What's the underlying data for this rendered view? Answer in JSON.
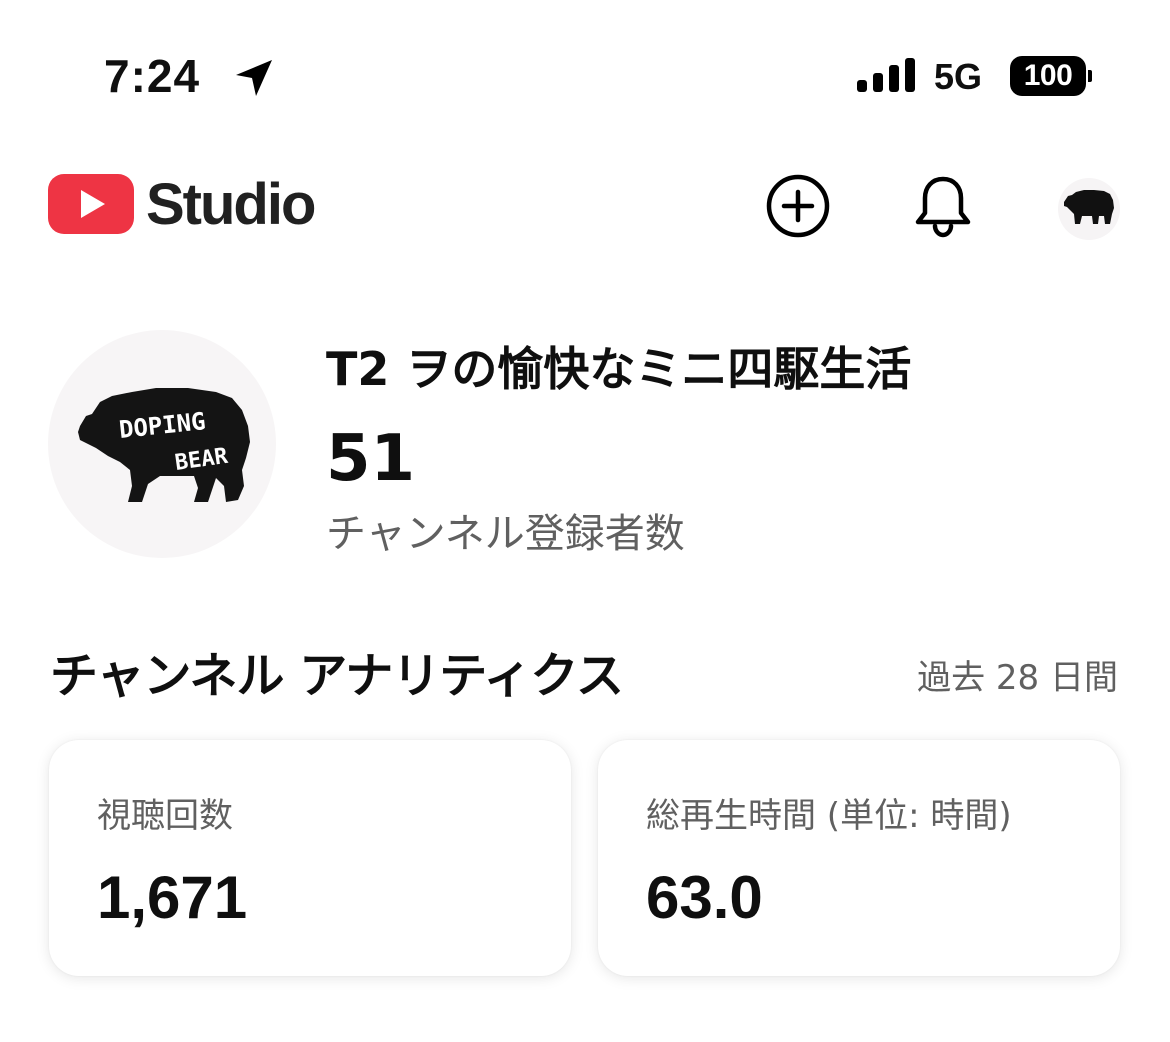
{
  "status_bar": {
    "time": "7:24",
    "network": "5G",
    "battery": "100"
  },
  "header": {
    "logo_text": "Studio",
    "brand_red": "#ff0000",
    "icons": [
      "youtube-logo-icon",
      "create-plus-icon",
      "bell-icon"
    ]
  },
  "channel": {
    "name": "T2 ヲの愉快なミニ四駆生活",
    "subscribers": "51",
    "subscribers_label": "チャンネル登録者数",
    "avatar_text_top": "DOPING",
    "avatar_text_bottom": "BEAR"
  },
  "analytics": {
    "title": "チャンネル アナリティクス",
    "period": "過去 28 日間",
    "cards": [
      {
        "label": "視聴回数",
        "value": "1,671"
      },
      {
        "label": "総再生時間 (単位: 時間)",
        "value": "63.0"
      }
    ]
  }
}
